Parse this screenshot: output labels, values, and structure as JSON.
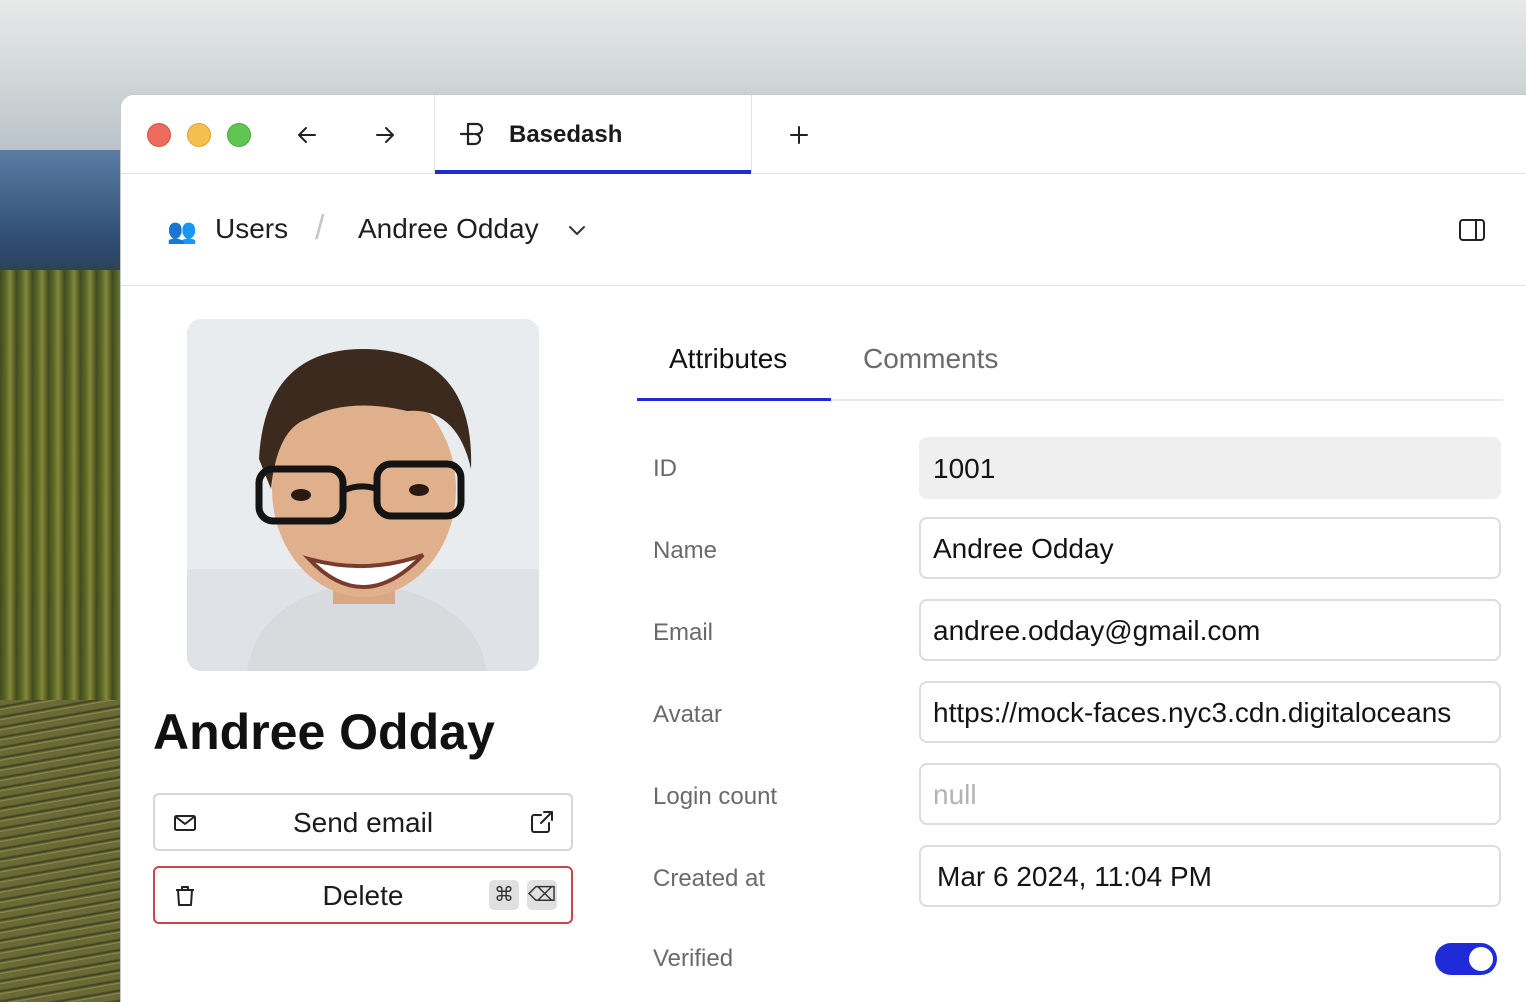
{
  "titlebar": {
    "tab_title": "Basedash"
  },
  "breadcrumb": {
    "table": "Users",
    "separator": "/",
    "record": "Andree Odday"
  },
  "record": {
    "name": "Andree Odday",
    "send_email_label": "Send email",
    "delete_label": "Delete",
    "shortcut_cmd": "⌘",
    "shortcut_del": "⌫"
  },
  "panel_tabs": {
    "attributes": "Attributes",
    "comments": "Comments"
  },
  "fields": {
    "id": {
      "label": "ID",
      "value": "1001"
    },
    "name": {
      "label": "Name",
      "value": "Andree Odday"
    },
    "email": {
      "label": "Email",
      "value": "andree.odday@gmail.com"
    },
    "avatar": {
      "label": "Avatar",
      "value": "https://mock-faces.nyc3.cdn.digitaloceans"
    },
    "login_count": {
      "label": "Login count",
      "value": "null"
    },
    "created_at": {
      "label": "Created at",
      "value": "Mar 6 2024, 11:04 PM"
    },
    "verified": {
      "label": "Verified",
      "value": true
    }
  },
  "colors": {
    "accent": "#1f2bd6",
    "danger": "#c9474b"
  }
}
